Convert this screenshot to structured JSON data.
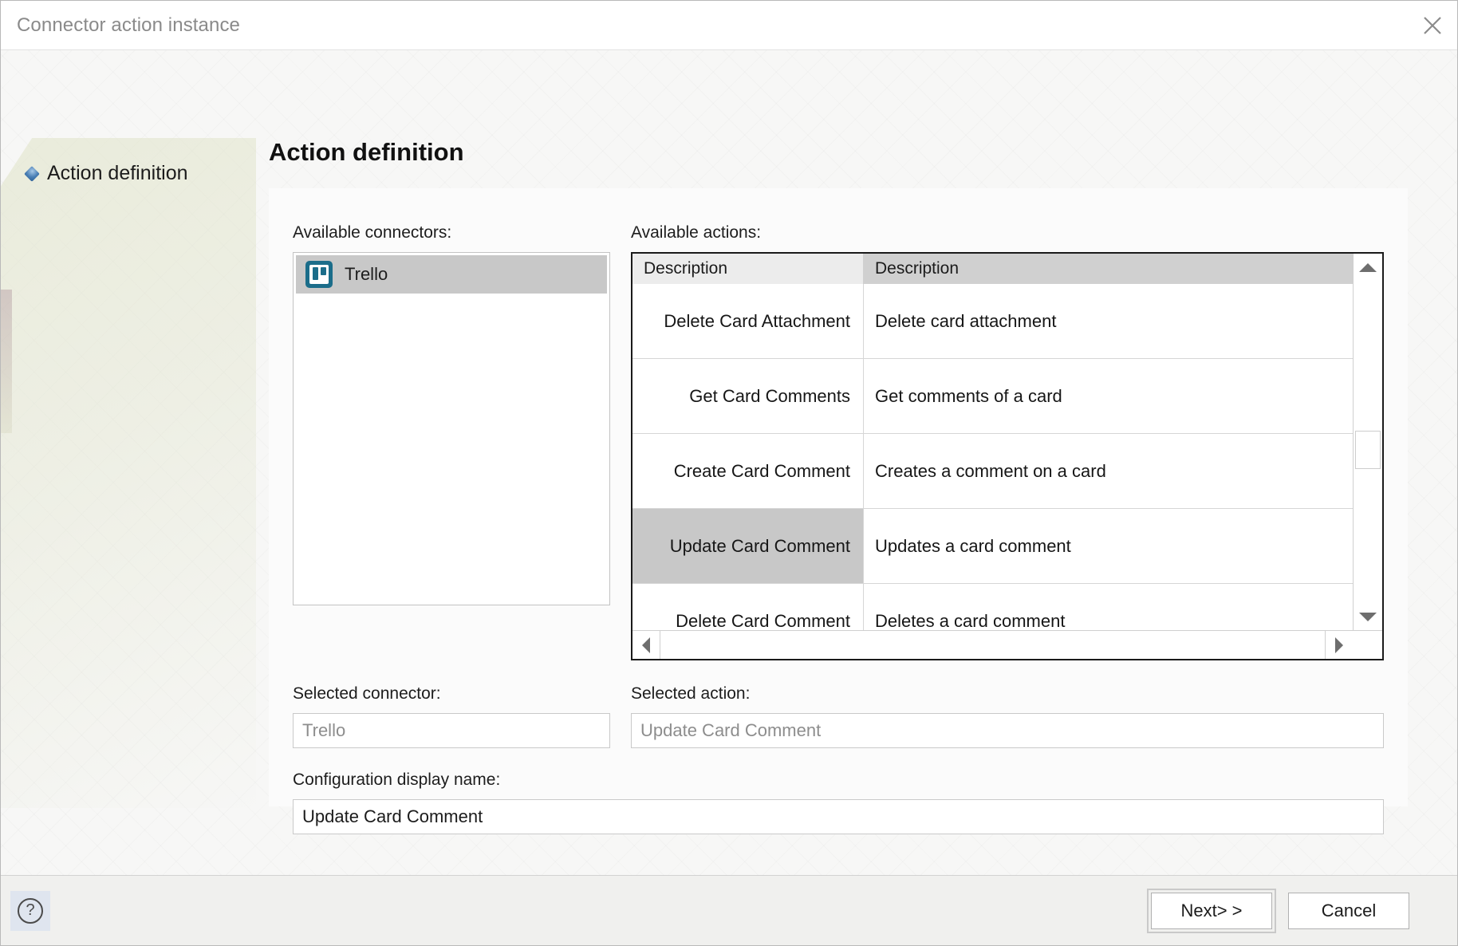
{
  "window": {
    "title": "Connector action instance",
    "close_icon": "close-icon"
  },
  "sidebar": {
    "items": [
      {
        "label": "Action definition",
        "icon": "diamond-bullet-icon",
        "selected": true
      }
    ]
  },
  "main": {
    "page_title": "Action definition",
    "connectors": {
      "label": "Available connectors:",
      "items": [
        {
          "name": "Trello",
          "icon": "trello-icon",
          "selected": true
        }
      ]
    },
    "actions": {
      "label": "Available actions:",
      "columns": [
        "Description",
        "Description"
      ],
      "rows": [
        {
          "name": "Delete Card Attachment",
          "description": "Delete card attachment",
          "selected": false
        },
        {
          "name": "Get Card Comments",
          "description": "Get comments of a card",
          "selected": false
        },
        {
          "name": "Create Card Comment",
          "description": "Creates a comment on a card",
          "selected": false
        },
        {
          "name": "Update Card Comment",
          "description": "Updates a card comment",
          "selected": true
        },
        {
          "name": "Delete Card Comment",
          "description": "Deletes a card comment",
          "selected": false
        }
      ]
    },
    "selected_connector": {
      "label": "Selected connector:",
      "value": "Trello"
    },
    "selected_action": {
      "label": "Selected action:",
      "value": "Update Card Comment"
    },
    "configuration_display_name": {
      "label": "Configuration display name:",
      "value": "Update Card Comment"
    }
  },
  "footer": {
    "help_icon": "question-mark-icon",
    "next_label": "Next> >",
    "cancel_label": "Cancel"
  },
  "colors": {
    "selection": "#c8c8c8",
    "trello_brand": "#1b6d8a",
    "title_text": "#8a8a8a"
  }
}
